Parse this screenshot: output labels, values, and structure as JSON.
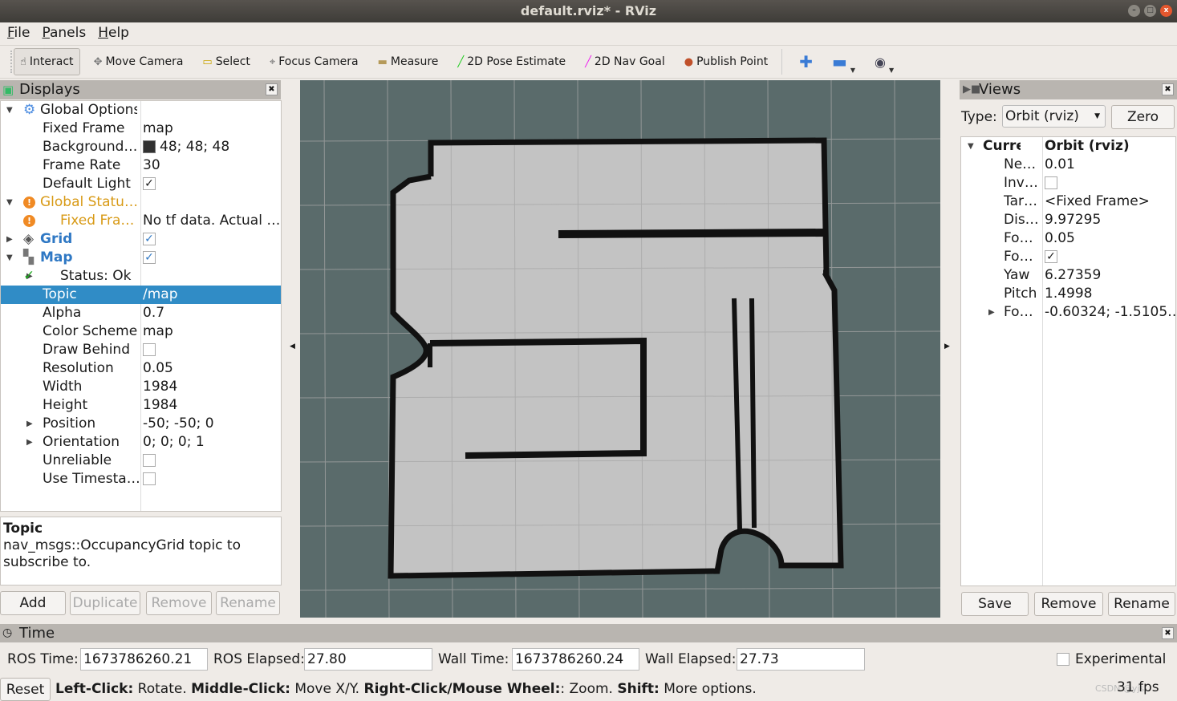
{
  "window": {
    "title": "default.rviz* - RViz"
  },
  "menu": [
    "File",
    "Panels",
    "Help"
  ],
  "toolbar": {
    "tools": [
      {
        "label": "Interact",
        "icon": "hand-icon",
        "active": true
      },
      {
        "label": "Move Camera",
        "icon": "move-camera-icon"
      },
      {
        "label": "Select",
        "icon": "select-icon"
      },
      {
        "label": "Focus Camera",
        "icon": "focus-camera-icon"
      },
      {
        "label": "Measure",
        "icon": "ruler-icon"
      },
      {
        "label": "2D Pose Estimate",
        "icon": "green-arrow-icon"
      },
      {
        "label": "2D Nav Goal",
        "icon": "magenta-arrow-icon"
      },
      {
        "label": "Publish Point",
        "icon": "map-pin-icon"
      }
    ]
  },
  "displays": {
    "title": "Displays",
    "rows": [
      {
        "indent": 0,
        "arrow": "down",
        "icon": "gear-icon",
        "key": "Global Options",
        "value": ""
      },
      {
        "indent": 1,
        "key": "Fixed Frame",
        "value": "map"
      },
      {
        "indent": 1,
        "key": "Background…",
        "value": "48; 48; 48",
        "swatch": "#303030"
      },
      {
        "indent": 1,
        "key": "Frame Rate",
        "value": "30"
      },
      {
        "indent": 1,
        "key": "Default Light",
        "check": true
      },
      {
        "indent": 0,
        "arrow": "down",
        "icon": "warning-icon",
        "key": "Global Statu…",
        "value": "",
        "warn": true
      },
      {
        "indent": 1,
        "icon": "warning-icon",
        "key": "Fixed Fra…",
        "value": "No tf data.  Actual …",
        "warn": true
      },
      {
        "indent": 0,
        "arrow": "right",
        "icon": "grid-icon",
        "key": "Grid",
        "check": true,
        "blue": true
      },
      {
        "indent": 0,
        "arrow": "down",
        "icon": "map-icon",
        "key": "Map",
        "check": true,
        "blue": true
      },
      {
        "indent": 1,
        "arrow": "right",
        "icon": "checkmark-icon",
        "key": "Status: Ok",
        "value": ""
      },
      {
        "indent": 1,
        "key": "Topic",
        "value": "/map",
        "selected": true
      },
      {
        "indent": 1,
        "key": "Alpha",
        "value": "0.7"
      },
      {
        "indent": 1,
        "key": "Color Scheme",
        "value": "map"
      },
      {
        "indent": 1,
        "key": "Draw Behind",
        "check": false
      },
      {
        "indent": 1,
        "key": "Resolution",
        "value": "0.05"
      },
      {
        "indent": 1,
        "key": "Width",
        "value": "1984"
      },
      {
        "indent": 1,
        "key": "Height",
        "value": "1984"
      },
      {
        "indent": 1,
        "arrow": "right",
        "key": "Position",
        "value": "-50; -50; 0"
      },
      {
        "indent": 1,
        "arrow": "right",
        "key": "Orientation",
        "value": "0; 0; 0; 1"
      },
      {
        "indent": 1,
        "key": "Unreliable",
        "check": false
      },
      {
        "indent": 1,
        "key": "Use Timesta…",
        "check": false
      }
    ],
    "desc_title": "Topic",
    "desc_text": "nav_msgs::OccupancyGrid topic to subscribe to.",
    "buttons": [
      {
        "label": "Add",
        "enabled": true
      },
      {
        "label": "Duplicate",
        "enabled": false
      },
      {
        "label": "Remove",
        "enabled": false
      },
      {
        "label": "Rename",
        "enabled": false
      }
    ]
  },
  "views": {
    "title": "Views",
    "type_label": "Type:",
    "type_value": "Orbit (rviz)",
    "zero": "Zero",
    "rows": [
      {
        "arrow": "down",
        "key": "Curre…",
        "value": "Orbit (rviz)",
        "bold": true
      },
      {
        "key": "Ne…",
        "value": "0.01"
      },
      {
        "key": "Inv…",
        "check": false
      },
      {
        "key": "Tar…",
        "value": "<Fixed Frame>"
      },
      {
        "key": "Dis…",
        "value": "9.97295"
      },
      {
        "key": "Fo…",
        "value": "0.05"
      },
      {
        "key": "Fo…",
        "check": true
      },
      {
        "key": "Yaw",
        "value": "6.27359"
      },
      {
        "key": "Pitch",
        "value": "1.4998"
      },
      {
        "arrow": "right",
        "key": "Fo…",
        "value": "-0.60324; -1.5105…"
      }
    ],
    "buttons": [
      "Save",
      "Remove",
      "Rename"
    ]
  },
  "time": {
    "title": "Time",
    "ros_time_label": "ROS Time:",
    "ros_time": "1673786260.21",
    "ros_elapsed_label": "ROS Elapsed:",
    "ros_elapsed": "27.80",
    "wall_time_label": "Wall Time:",
    "wall_time": "1673786260.24",
    "wall_elapsed_label": "Wall Elapsed:",
    "wall_elapsed": "27.73",
    "experimental": "Experimental"
  },
  "status": {
    "reset": "Reset",
    "hint": [
      [
        "Left-Click:",
        " Rotate. "
      ],
      [
        "Middle-Click:",
        " Move X/Y. "
      ],
      [
        "Right-Click/Mouse Wheel:",
        ": Zoom. "
      ],
      [
        "Shift:",
        " More options."
      ]
    ],
    "fps": "31 fps",
    "watermark": "CSDN @yjs"
  },
  "colors": {
    "viewport_bg": "#5a6b6b",
    "free": "#c3c3c3",
    "occupied": "#111111",
    "selection": "#308cc6"
  }
}
